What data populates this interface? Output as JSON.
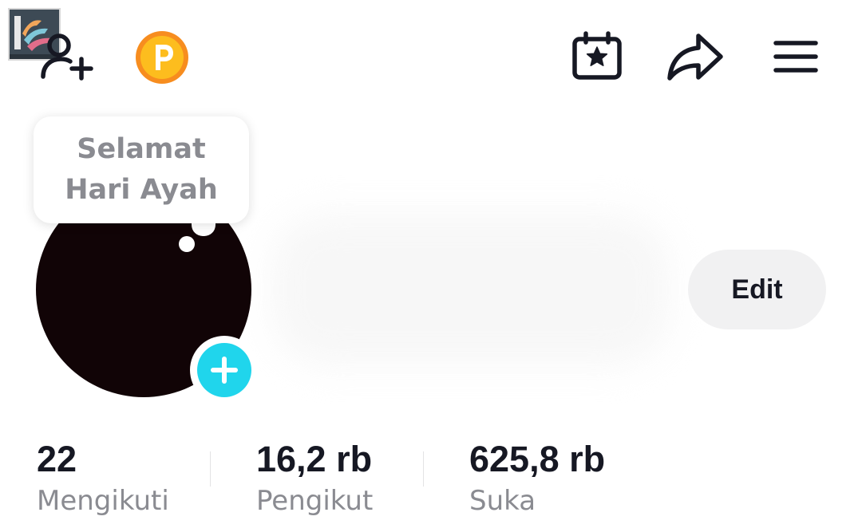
{
  "header": {
    "icons": [
      "add-friend-icon",
      "coin-icon",
      "calendar-star-icon",
      "share-icon",
      "menu-icon"
    ],
    "coin_letter": "P",
    "coin_color": "#fdbd1e",
    "coin_ring_color": "#f78d1f"
  },
  "bubble": {
    "line1": "Selamat",
    "line2": "Hari Ayah"
  },
  "profile": {
    "avatar_color": "#110406",
    "add_button_color": "#20d5ec",
    "edit_label": "Edit"
  },
  "stats": {
    "following_value": "22",
    "following_label": "Mengikuti",
    "followers_value": "16,2 rb",
    "followers_label": "Pengikut",
    "likes_value": "625,8 rb",
    "likes_label": "Suka"
  }
}
